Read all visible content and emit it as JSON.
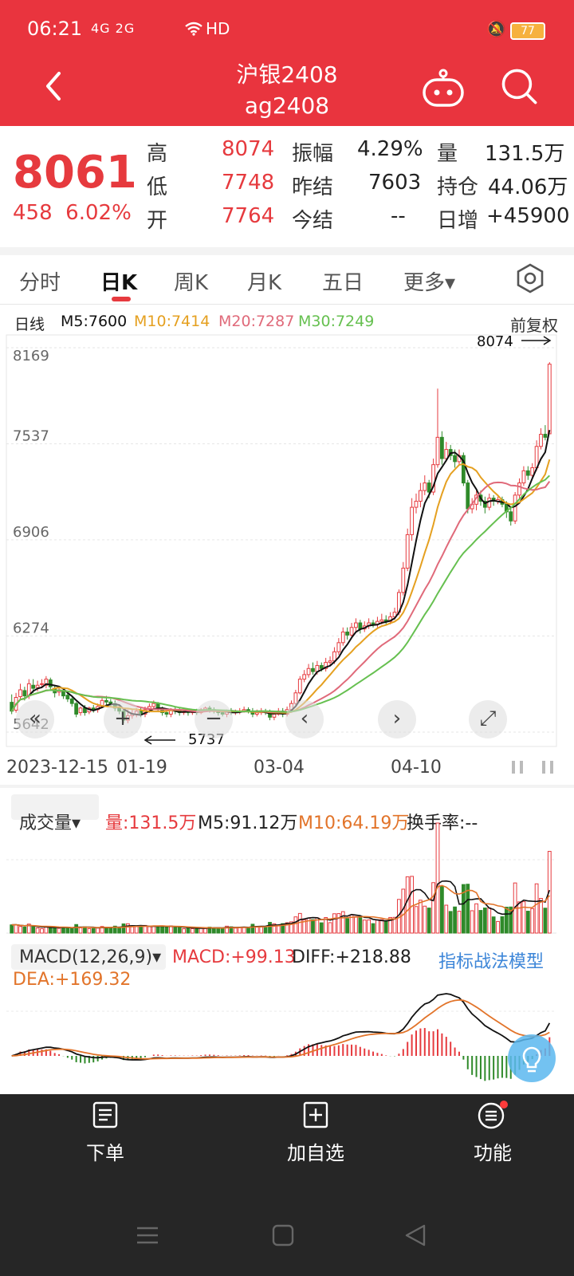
{
  "status": {
    "time": "06:21",
    "signal": "4G 2G",
    "hd": "HD",
    "battery": "77"
  },
  "header": {
    "title": "沪银2408",
    "subtitle": "ag2408"
  },
  "quote": {
    "price": "8061",
    "change": "458",
    "change_pct": "6.02%",
    "high_label": "高",
    "high": "8074",
    "low_label": "低",
    "low": "7748",
    "open_label": "开",
    "open": "7764",
    "amp_label": "振幅",
    "amp": "4.29%",
    "prev_settle_label": "昨结",
    "prev_settle": "7603",
    "settle_label": "今结",
    "settle": "--",
    "vol_label": "量",
    "vol": "131.5万",
    "oi_label": "持仓",
    "oi": "44.06万",
    "day_inc_label": "日增",
    "day_inc": "+45900"
  },
  "tabs": [
    "分时",
    "日K",
    "周K",
    "月K",
    "五日",
    "更多▾"
  ],
  "active_tab": "日K",
  "ma_legend": {
    "prefix": "日线",
    "m5": "M5:7600",
    "m10": "M10:7414",
    "m20": "M20:7287",
    "m30": "M30:7249",
    "fq": "前复权"
  },
  "colors": {
    "red": "#e63a3e",
    "green": "#2f8a2a",
    "m5": "#111111",
    "m10": "#e5a020",
    "m20": "#e06a7a",
    "m30": "#66c050",
    "header": "#e9343e"
  },
  "chart_data": {
    "type": "candlestick",
    "y_ticks": [
      "8169",
      "7537",
      "6906",
      "6274",
      "5642"
    ],
    "ylim": [
      5642,
      8169
    ],
    "x_ticks": [
      "2023-12-15",
      "01-19",
      "03-04",
      "04-10"
    ],
    "annotations": {
      "high": "8074",
      "low": "5737"
    },
    "candles": [
      [
        5838,
        5780,
        5890,
        5760
      ],
      [
        5786,
        5870,
        5900,
        5770
      ],
      [
        5875,
        5920,
        5960,
        5860
      ],
      [
        5915,
        5880,
        5940,
        5850
      ],
      [
        5880,
        5960,
        5990,
        5860
      ],
      [
        5950,
        5930,
        5990,
        5900
      ],
      [
        5935,
        5950,
        5980,
        5910
      ],
      [
        5960,
        5960,
        5990,
        5930
      ],
      [
        5950,
        5990,
        6010,
        5930
      ],
      [
        5985,
        5940,
        6000,
        5920
      ],
      [
        5930,
        5900,
        5950,
        5870
      ],
      [
        5905,
        5920,
        5940,
        5880
      ],
      [
        5915,
        5880,
        5930,
        5860
      ],
      [
        5885,
        5860,
        5900,
        5840
      ],
      [
        5860,
        5830,
        5870,
        5810
      ],
      [
        5830,
        5760,
        5840,
        5740
      ],
      [
        5770,
        5800,
        5810,
        5750
      ],
      [
        5800,
        5770,
        5820,
        5750
      ],
      [
        5775,
        5800,
        5810,
        5760
      ],
      [
        5800,
        5790,
        5820,
        5770
      ],
      [
        5790,
        5810,
        5830,
        5770
      ],
      [
        5810,
        5850,
        5870,
        5800
      ],
      [
        5850,
        5840,
        5880,
        5820
      ],
      [
        5840,
        5830,
        5860,
        5810
      ],
      [
        5830,
        5800,
        5850,
        5780
      ],
      [
        5800,
        5780,
        5810,
        5760
      ],
      [
        5780,
        5720,
        5790,
        5700
      ],
      [
        5720,
        5750,
        5790,
        5700
      ],
      [
        5750,
        5760,
        5790,
        5730
      ],
      [
        5760,
        5780,
        5800,
        5740
      ],
      [
        5780,
        5760,
        5800,
        5740
      ],
      [
        5760,
        5790,
        5810,
        5740
      ],
      [
        5790,
        5810,
        5830,
        5770
      ],
      [
        5810,
        5830,
        5850,
        5790
      ],
      [
        5830,
        5800,
        5840,
        5780
      ],
      [
        5800,
        5770,
        5810,
        5750
      ],
      [
        5770,
        5760,
        5790,
        5740
      ],
      [
        5760,
        5790,
        5800,
        5740
      ],
      [
        5790,
        5780,
        5810,
        5760
      ],
      [
        5780,
        5770,
        5800,
        5750
      ],
      [
        5770,
        5775,
        5790,
        5755
      ],
      [
        5775,
        5770,
        5790,
        5750
      ],
      [
        5770,
        5780,
        5790,
        5755
      ],
      [
        5780,
        5770,
        5795,
        5755
      ],
      [
        5770,
        5790,
        5800,
        5760
      ],
      [
        5790,
        5800,
        5810,
        5775
      ],
      [
        5800,
        5790,
        5815,
        5770
      ],
      [
        5790,
        5780,
        5805,
        5765
      ],
      [
        5780,
        5770,
        5790,
        5750
      ],
      [
        5770,
        5760,
        5780,
        5745
      ],
      [
        5760,
        5780,
        5790,
        5740
      ],
      [
        5780,
        5770,
        5800,
        5755
      ],
      [
        5770,
        5775,
        5790,
        5755
      ],
      [
        5775,
        5780,
        5800,
        5760
      ],
      [
        5780,
        5790,
        5810,
        5770
      ],
      [
        5790,
        5780,
        5805,
        5765
      ],
      [
        5780,
        5760,
        5800,
        5740
      ],
      [
        5760,
        5770,
        5790,
        5745
      ],
      [
        5770,
        5780,
        5800,
        5755
      ],
      [
        5780,
        5770,
        5795,
        5755
      ],
      [
        5770,
        5740,
        5790,
        5720
      ],
      [
        5740,
        5760,
        5780,
        5720
      ],
      [
        5760,
        5780,
        5800,
        5750
      ],
      [
        5780,
        5760,
        5800,
        5740
      ],
      [
        5760,
        5790,
        5810,
        5745
      ],
      [
        5790,
        5830,
        5850,
        5780
      ],
      [
        5830,
        5900,
        5920,
        5820
      ],
      [
        5900,
        5990,
        6010,
        5890
      ],
      [
        5990,
        6020,
        6050,
        5970
      ],
      [
        6020,
        6060,
        6090,
        6000
      ],
      [
        6060,
        6040,
        6100,
        6020
      ],
      [
        6040,
        6080,
        6110,
        6020
      ],
      [
        6080,
        6060,
        6100,
        6040
      ],
      [
        6060,
        6100,
        6130,
        6040
      ],
      [
        6100,
        6110,
        6140,
        6080
      ],
      [
        6110,
        6170,
        6200,
        6090
      ],
      [
        6170,
        6230,
        6260,
        6150
      ],
      [
        6230,
        6300,
        6330,
        6210
      ],
      [
        6300,
        6280,
        6330,
        6250
      ],
      [
        6280,
        6330,
        6360,
        6260
      ],
      [
        6330,
        6360,
        6390,
        6300
      ],
      [
        6360,
        6320,
        6380,
        6290
      ],
      [
        6320,
        6340,
        6370,
        6300
      ],
      [
        6340,
        6360,
        6390,
        6320
      ],
      [
        6360,
        6350,
        6380,
        6330
      ],
      [
        6350,
        6370,
        6400,
        6330
      ],
      [
        6370,
        6380,
        6420,
        6350
      ],
      [
        6380,
        6370,
        6410,
        6350
      ],
      [
        6370,
        6400,
        6430,
        6350
      ],
      [
        6400,
        6430,
        6460,
        6380
      ],
      [
        6430,
        6560,
        6580,
        6410
      ],
      [
        6560,
        6720,
        6760,
        6540
      ],
      [
        6720,
        6940,
        6980,
        6700
      ],
      [
        6940,
        7120,
        7180,
        6900
      ],
      [
        7120,
        7160,
        7210,
        7080
      ],
      [
        7160,
        7230,
        7280,
        7120
      ],
      [
        7230,
        7280,
        7330,
        7200
      ],
      [
        7280,
        7220,
        7300,
        7180
      ],
      [
        7220,
        7400,
        7440,
        7200
      ],
      [
        7400,
        7580,
        7900,
        7380
      ],
      [
        7580,
        7440,
        7620,
        7400
      ],
      [
        7440,
        7500,
        7550,
        7420
      ],
      [
        7500,
        7460,
        7530,
        7430
      ],
      [
        7460,
        7420,
        7500,
        7380
      ],
      [
        7420,
        7460,
        7500,
        7400
      ],
      [
        7460,
        7280,
        7480,
        7260
      ],
      [
        7280,
        7110,
        7300,
        7080
      ],
      [
        7110,
        7140,
        7180,
        7080
      ],
      [
        7140,
        7200,
        7230,
        7100
      ],
      [
        7200,
        7160,
        7230,
        7130
      ],
      [
        7160,
        7120,
        7190,
        7080
      ],
      [
        7120,
        7180,
        7210,
        7100
      ],
      [
        7180,
        7160,
        7200,
        7130
      ],
      [
        7160,
        7170,
        7190,
        7140
      ],
      [
        7170,
        7140,
        7190,
        7120
      ],
      [
        7140,
        7090,
        7160,
        7050
      ],
      [
        7090,
        7030,
        7110,
        7000
      ],
      [
        7030,
        7200,
        7220,
        7010
      ],
      [
        7200,
        7280,
        7310,
        7180
      ],
      [
        7280,
        7360,
        7390,
        7260
      ],
      [
        7360,
        7330,
        7390,
        7300
      ],
      [
        7330,
        7380,
        7410,
        7310
      ],
      [
        7380,
        7520,
        7560,
        7360
      ],
      [
        7520,
        7600,
        7640,
        7500
      ],
      [
        7600,
        7580,
        7660,
        7560
      ],
      [
        7603,
        8061,
        8074,
        7748
      ]
    ],
    "ma_series": [
      "M5",
      "M10",
      "M20",
      "M30"
    ],
    "volume": {
      "legend_name": "成交量▾",
      "vol": "量:131.5万",
      "m5": "M5:91.12万",
      "m10": "M10:64.19万",
      "turnover": "换手率:--"
    },
    "macd": {
      "label": "MACD(12,26,9)▾",
      "macd": "MACD:+99.13",
      "diff": "DIFF:+218.88",
      "dea": "DEA:+169.32",
      "model": "指标战法模型"
    }
  },
  "chart_nav": [
    "«",
    "+",
    "−",
    "‹",
    "›",
    "⤢"
  ],
  "bottom_nav": [
    {
      "label": "下单",
      "icon": "order-icon"
    },
    {
      "label": "加自选",
      "icon": "add-watchlist-icon"
    },
    {
      "label": "功能",
      "icon": "menu-icon"
    }
  ]
}
